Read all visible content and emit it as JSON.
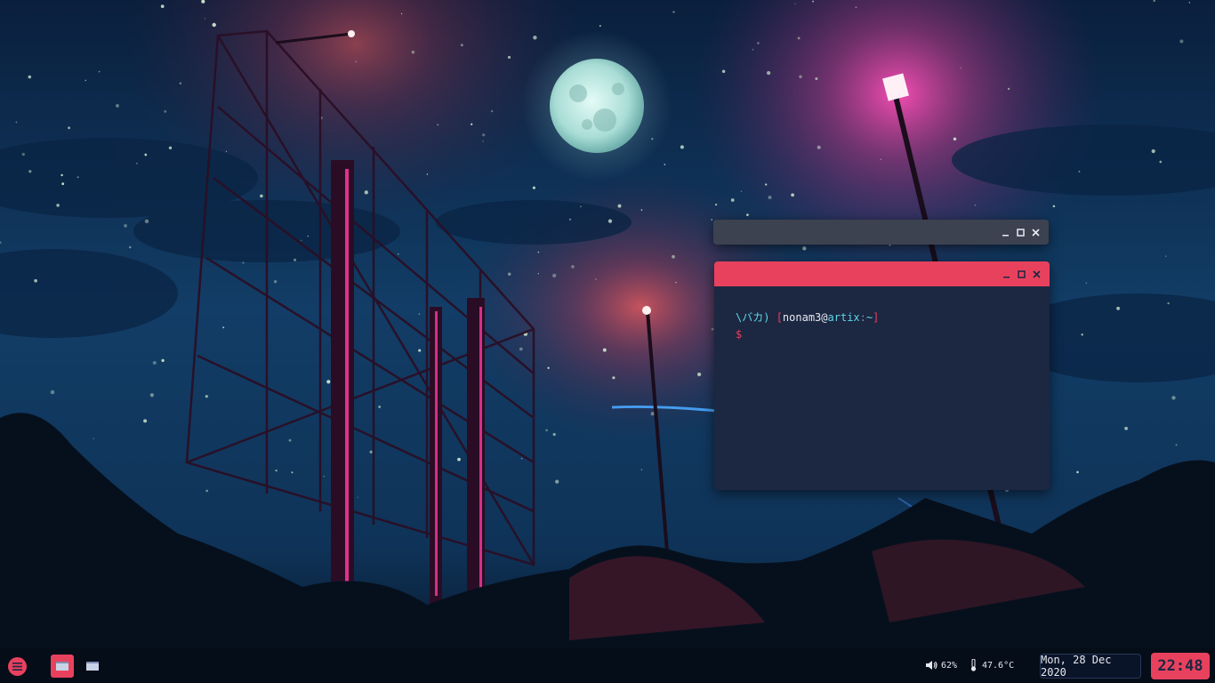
{
  "colors": {
    "accent": "#e8415e",
    "terminal_bg": "#1c2742",
    "inactive_titlebar": "#3d4250",
    "prompt_cyan": "#5fd7e8",
    "text": "#e6e9f0"
  },
  "windows": [
    {
      "name": "inactive-window",
      "controls": [
        "minimize-icon",
        "maximize-icon",
        "close-icon"
      ]
    },
    {
      "name": "terminal-window",
      "controls": [
        "minimize-icon",
        "maximize-icon",
        "close-icon"
      ],
      "prompt": {
        "symbol": "\\バカ)",
        "open_bracket": "[",
        "user": "nonam3",
        "at": "@",
        "host": "artix",
        "colon": ":",
        "path": "~",
        "close_bracket": "]",
        "cursor": "$"
      }
    }
  ],
  "panel": {
    "launcher_icon": "menu-icon",
    "tasks": [
      {
        "icon": "window-icon",
        "active": true
      },
      {
        "icon": "window-icon",
        "active": false
      }
    ],
    "volume": {
      "icon": "volume-icon",
      "value": "62%"
    },
    "temperature": {
      "icon": "thermometer-icon",
      "value": "47.6°C"
    },
    "date": "Mon, 28 Dec 2020",
    "time": "22:48"
  }
}
